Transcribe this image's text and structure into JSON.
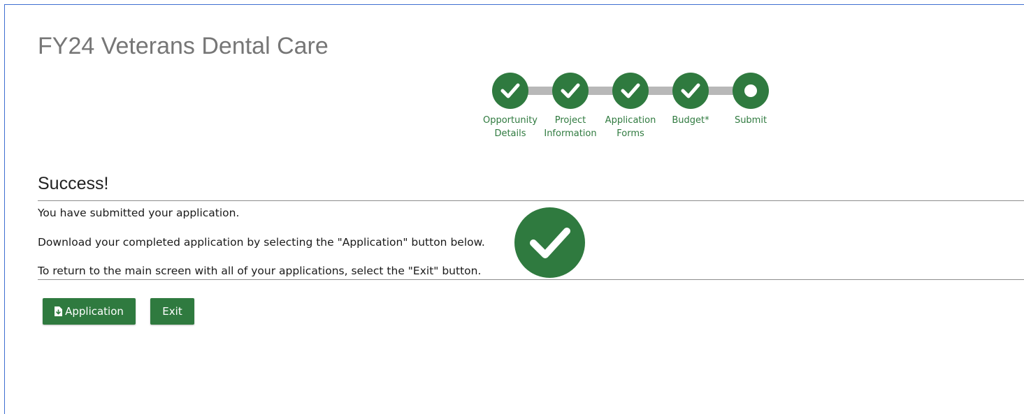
{
  "page": {
    "title": "FY24 Veterans Dental Care"
  },
  "stepper": {
    "steps": [
      {
        "label": "Opportunity\nDetails",
        "state": "complete",
        "icon": "check-icon"
      },
      {
        "label": "Project\nInformation",
        "state": "complete",
        "icon": "check-icon"
      },
      {
        "label": "Application\nForms",
        "state": "complete",
        "icon": "check-icon"
      },
      {
        "label": "Budget*",
        "state": "complete",
        "icon": "check-icon"
      },
      {
        "label": "Submit",
        "state": "current",
        "icon": "dot-icon"
      }
    ]
  },
  "success": {
    "heading": "Success!",
    "line1": "You have submitted your application.",
    "line2": "Download your completed application by selecting the \"Application\" button below.",
    "line3": "To return to the main screen with all of your applications, select the \"Exit\" button.",
    "icon": "large-check-icon"
  },
  "buttons": {
    "application_label": "Application",
    "application_icon": "file-download-icon",
    "exit_label": "Exit"
  },
  "colors": {
    "accent": "#2f7a3f",
    "connector": "#b8b8b8",
    "title": "#767676"
  }
}
